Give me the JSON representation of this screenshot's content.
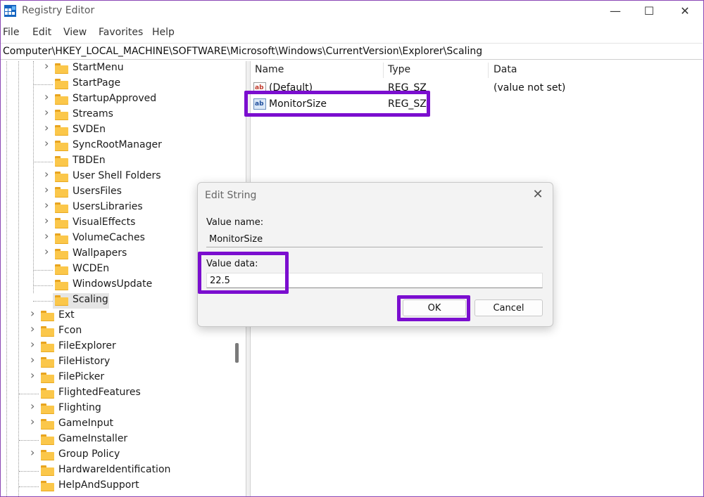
{
  "window": {
    "title": "Registry Editor",
    "controls": {
      "minimize": "—",
      "maximize": "☐",
      "close": "✕"
    }
  },
  "menu": [
    "File",
    "Edit",
    "View",
    "Favorites",
    "Help"
  ],
  "address": "Computer\\HKEY_LOCAL_MACHINE\\SOFTWARE\\Microsoft\\Windows\\CurrentVersion\\Explorer\\Scaling",
  "tree": {
    "items": [
      {
        "label": "StartMenu",
        "expandable": true
      },
      {
        "label": "StartPage",
        "expandable": false
      },
      {
        "label": "StartupApproved",
        "expandable": true
      },
      {
        "label": "Streams",
        "expandable": true
      },
      {
        "label": "SVDEn",
        "expandable": true
      },
      {
        "label": "SyncRootManager",
        "expandable": true
      },
      {
        "label": "TBDEn",
        "expandable": false
      },
      {
        "label": "User Shell Folders",
        "expandable": true
      },
      {
        "label": "UsersFiles",
        "expandable": true
      },
      {
        "label": "UsersLibraries",
        "expandable": true
      },
      {
        "label": "VisualEffects",
        "expandable": true
      },
      {
        "label": "VolumeCaches",
        "expandable": true
      },
      {
        "label": "Wallpapers",
        "expandable": true
      },
      {
        "label": "WCDEn",
        "expandable": false
      },
      {
        "label": "WindowsUpdate",
        "expandable": false
      },
      {
        "label": "Scaling",
        "expandable": false,
        "selected": true
      },
      {
        "label": "Ext",
        "expandable": true
      },
      {
        "label": "Fcon",
        "expandable": true
      },
      {
        "label": "FileExplorer",
        "expandable": true
      },
      {
        "label": "FileHistory",
        "expandable": true
      },
      {
        "label": "FilePicker",
        "expandable": true
      },
      {
        "label": "FlightedFeatures",
        "expandable": false
      },
      {
        "label": "Flighting",
        "expandable": true
      },
      {
        "label": "GameInput",
        "expandable": true
      },
      {
        "label": "GameInstaller",
        "expandable": false
      },
      {
        "label": "Group Policy",
        "expandable": true
      },
      {
        "label": "HardwareIdentification",
        "expandable": false
      },
      {
        "label": "HelpAndSupport",
        "expandable": false
      }
    ]
  },
  "list": {
    "columns": [
      "Name",
      "Type",
      "Data"
    ],
    "rows": [
      {
        "name": "(Default)",
        "type": "REG_SZ",
        "data": "(value not set)"
      },
      {
        "name": "MonitorSize",
        "type": "REG_SZ",
        "data": ""
      }
    ]
  },
  "dialog": {
    "title": "Edit String",
    "close": "✕",
    "value_name_label": "Value name:",
    "value_name": "MonitorSize",
    "value_data_label": "Value data:",
    "value_data": "22.5",
    "ok_label": "OK",
    "cancel_label": "Cancel"
  },
  "colors": {
    "highlight": "#7b0ecf",
    "folder": "#fbc74a",
    "selection": "#e5e5e5"
  }
}
